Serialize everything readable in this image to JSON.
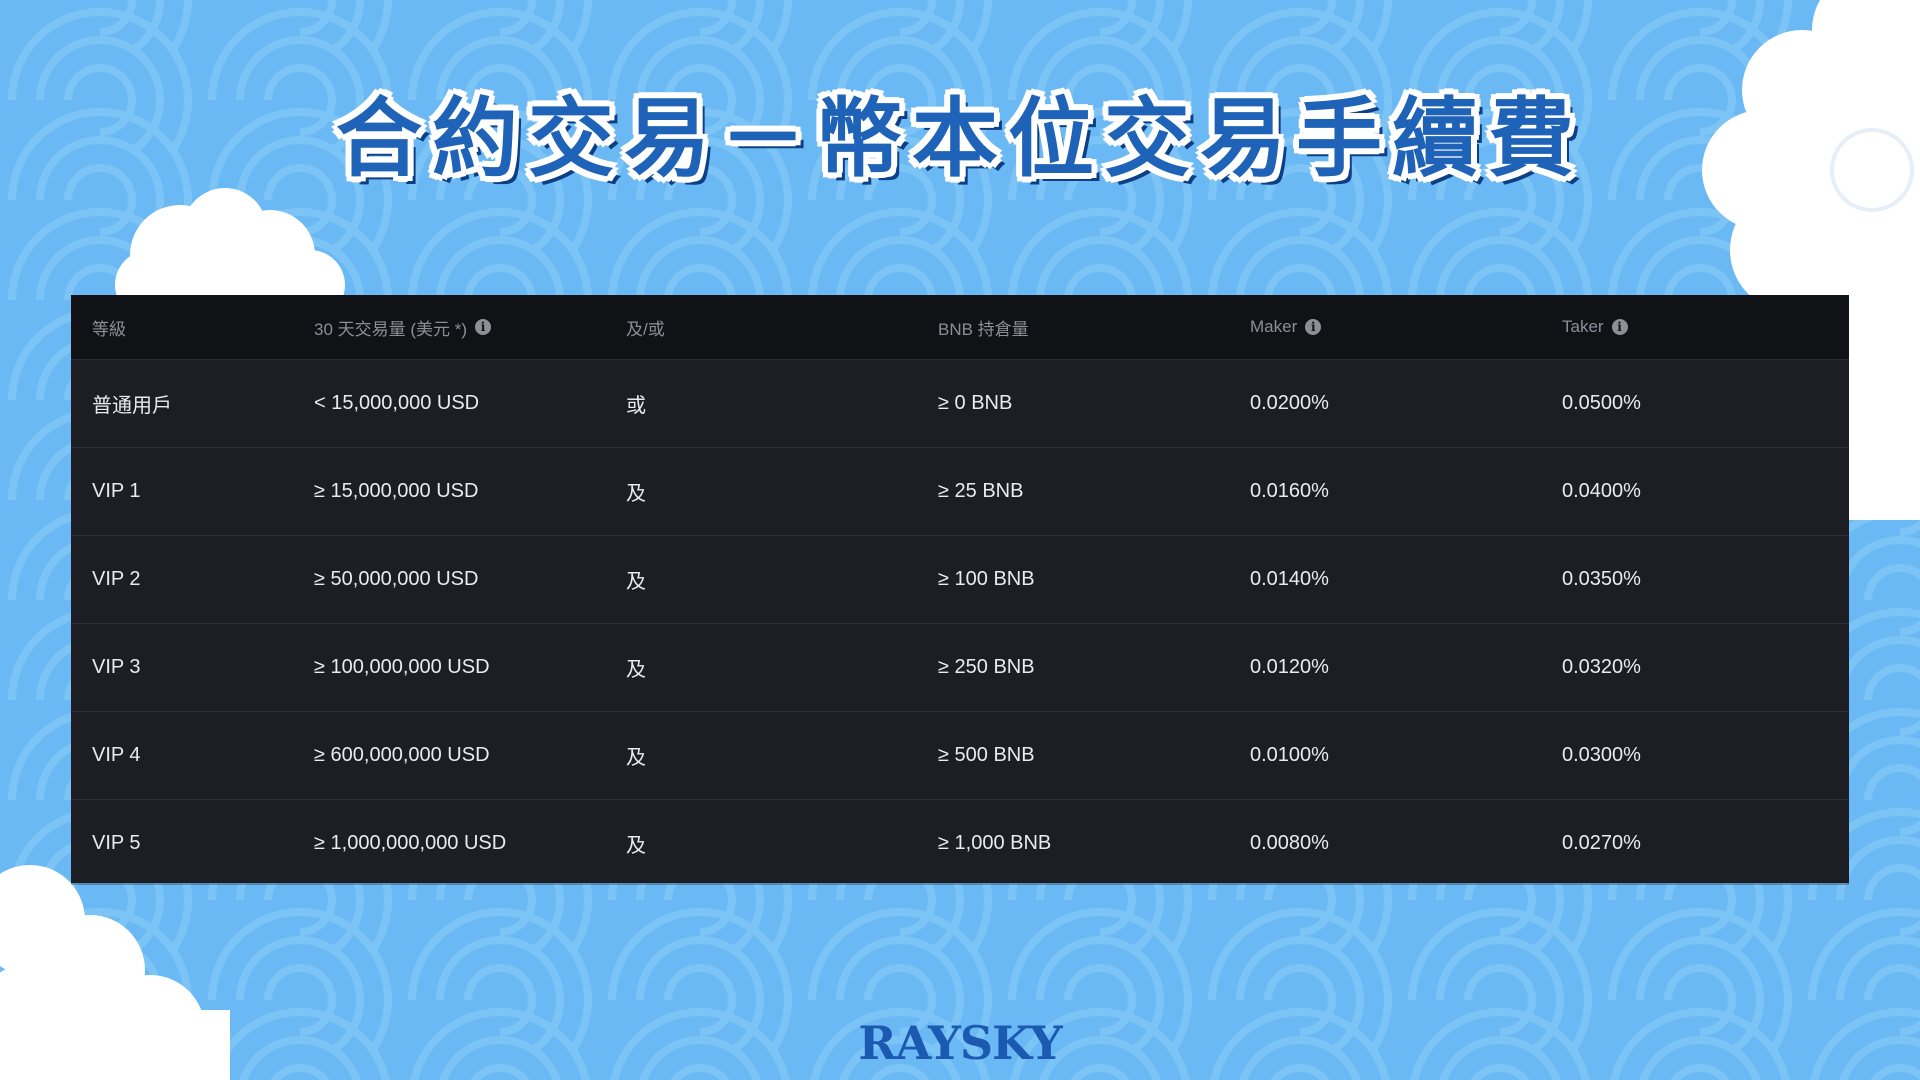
{
  "title": "合約交易－幣本位交易手續費",
  "table": {
    "headers": [
      "等級",
      "30 天交易量 (美元 *)",
      "及/或",
      "BNB 持倉量",
      "Maker",
      "Taker"
    ],
    "rows": [
      {
        "level": "普通用戶",
        "volume": "< 15,000,000 USD",
        "andor": "或",
        "bnb": "≥ 0 BNB",
        "maker": "0.0200%",
        "taker": "0.0500%"
      },
      {
        "level": "VIP 1",
        "volume": "≥ 15,000,000 USD",
        "andor": "及",
        "bnb": "≥ 25 BNB",
        "maker": "0.0160%",
        "taker": "0.0400%"
      },
      {
        "level": "VIP 2",
        "volume": "≥ 50,000,000 USD",
        "andor": "及",
        "bnb": "≥ 100 BNB",
        "maker": "0.0140%",
        "taker": "0.0350%"
      },
      {
        "level": "VIP 3",
        "volume": "≥ 100,000,000 USD",
        "andor": "及",
        "bnb": "≥ 250 BNB",
        "maker": "0.0120%",
        "taker": "0.0320%"
      },
      {
        "level": "VIP 4",
        "volume": "≥ 600,000,000 USD",
        "andor": "及",
        "bnb": "≥ 500 BNB",
        "maker": "0.0100%",
        "taker": "0.0300%"
      },
      {
        "level": "VIP 5",
        "volume": "≥ 1,000,000,000 USD",
        "andor": "及",
        "bnb": "≥ 1,000 BNB",
        "maker": "0.0080%",
        "taker": "0.0270%"
      }
    ]
  },
  "logo": "RAYSKY",
  "icons": {
    "info": "info-icon"
  },
  "colors": {
    "background": "#6ab8f4",
    "table_body": "#1c1e24",
    "table_header": "#101216",
    "title": "#1e63b7",
    "logo": "#1b5ab0"
  }
}
